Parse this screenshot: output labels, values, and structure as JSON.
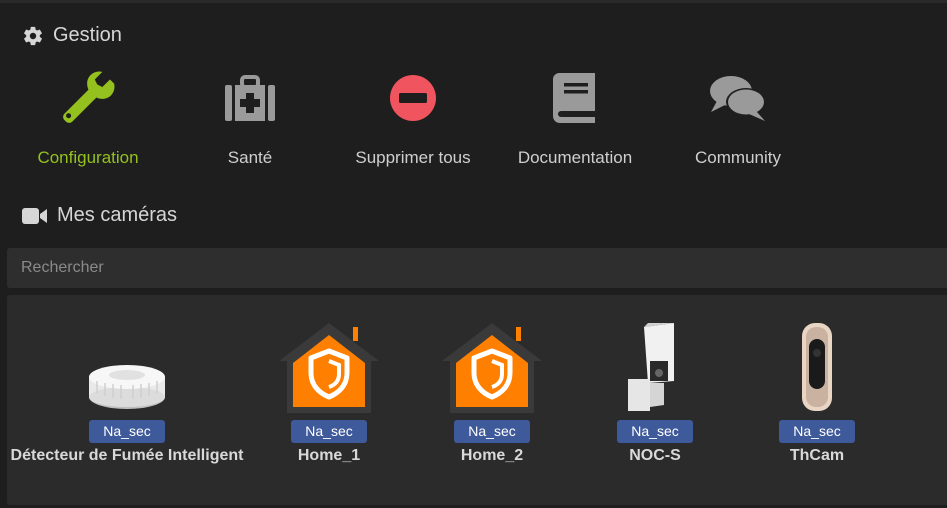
{
  "gestion": {
    "title": "Gestion",
    "icon": "gear-icon",
    "actions": [
      {
        "label": "Configuration",
        "icon": "wrench-icon",
        "color": "#95c11f"
      },
      {
        "label": "Santé",
        "icon": "medkit-icon",
        "color": "#9a9a9a"
      },
      {
        "label": "Supprimer tous",
        "icon": "minus-circle-icon",
        "color": "#f0545e"
      },
      {
        "label": "Documentation",
        "icon": "book-icon",
        "color": "#9a9a9a"
      },
      {
        "label": "Community",
        "icon": "comments-icon",
        "color": "#9a9a9a"
      }
    ]
  },
  "cameras": {
    "title": "Mes caméras",
    "icon": "video-camera-icon",
    "search_placeholder": "Rechercher",
    "items": [
      {
        "badge": "Na_sec",
        "name": "Détecteur de Fumée Intelligent",
        "image": "smoke-detector-image"
      },
      {
        "badge": "Na_sec",
        "name": "Home_1",
        "image": "home-shield-image"
      },
      {
        "badge": "Na_sec",
        "name": "Home_2",
        "image": "home-shield-image"
      },
      {
        "badge": "Na_sec",
        "name": "NOC-S",
        "image": "outdoor-camera-image"
      },
      {
        "badge": "Na_sec",
        "name": "ThCam",
        "image": "indoor-camera-image"
      }
    ]
  },
  "colors": {
    "background": "#1e1e1e",
    "accent": "#95c11f",
    "danger": "#f0545e",
    "badge": "#3f5a9a",
    "home_orange": "#ff7f00"
  }
}
